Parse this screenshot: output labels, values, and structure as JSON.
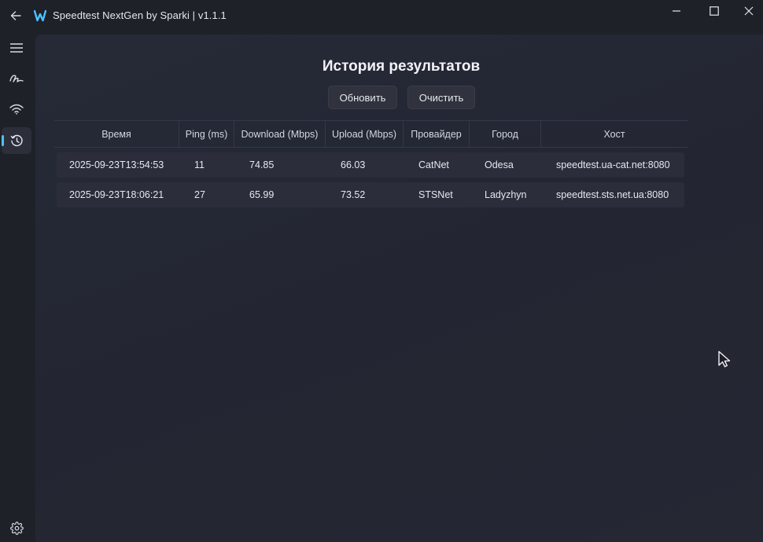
{
  "app": {
    "title": "Speedtest NextGen by Sparki | v1.1.1",
    "accent_color": "#4cc2ff"
  },
  "titlebar": {
    "back_icon": "arrow-left-icon",
    "minimize_icon": "minimize-icon",
    "maximize_icon": "maximize-icon",
    "close_icon": "close-icon"
  },
  "sidebar": {
    "items": [
      {
        "name": "menu",
        "icon": "hamburger-icon"
      },
      {
        "name": "speedtest",
        "icon": "speedometer-icon"
      },
      {
        "name": "wifi",
        "icon": "wifi-icon"
      },
      {
        "name": "history",
        "icon": "history-icon",
        "active": true
      },
      {
        "name": "settings",
        "icon": "gear-icon"
      }
    ]
  },
  "main": {
    "page_title": "История результатов",
    "refresh_label": "Обновить",
    "clear_label": "Очистить",
    "table": {
      "columns": [
        "Время",
        "Ping (ms)",
        "Download (Mbps)",
        "Upload (Mbps)",
        "Провайдер",
        "Город",
        "Хост"
      ],
      "rows": [
        {
          "time": "2025-09-23T13:54:53",
          "ping": "11",
          "download": "74.85",
          "upload": "66.03",
          "provider": "CatNet",
          "city": "Odesa",
          "host": "speedtest.ua-cat.net:8080"
        },
        {
          "time": "2025-09-23T18:06:21",
          "ping": "27",
          "download": "65.99",
          "upload": "73.52",
          "provider": "STSNet",
          "city": "Ladyzhyn",
          "host": "speedtest.sts.net.ua:8080"
        }
      ]
    }
  }
}
